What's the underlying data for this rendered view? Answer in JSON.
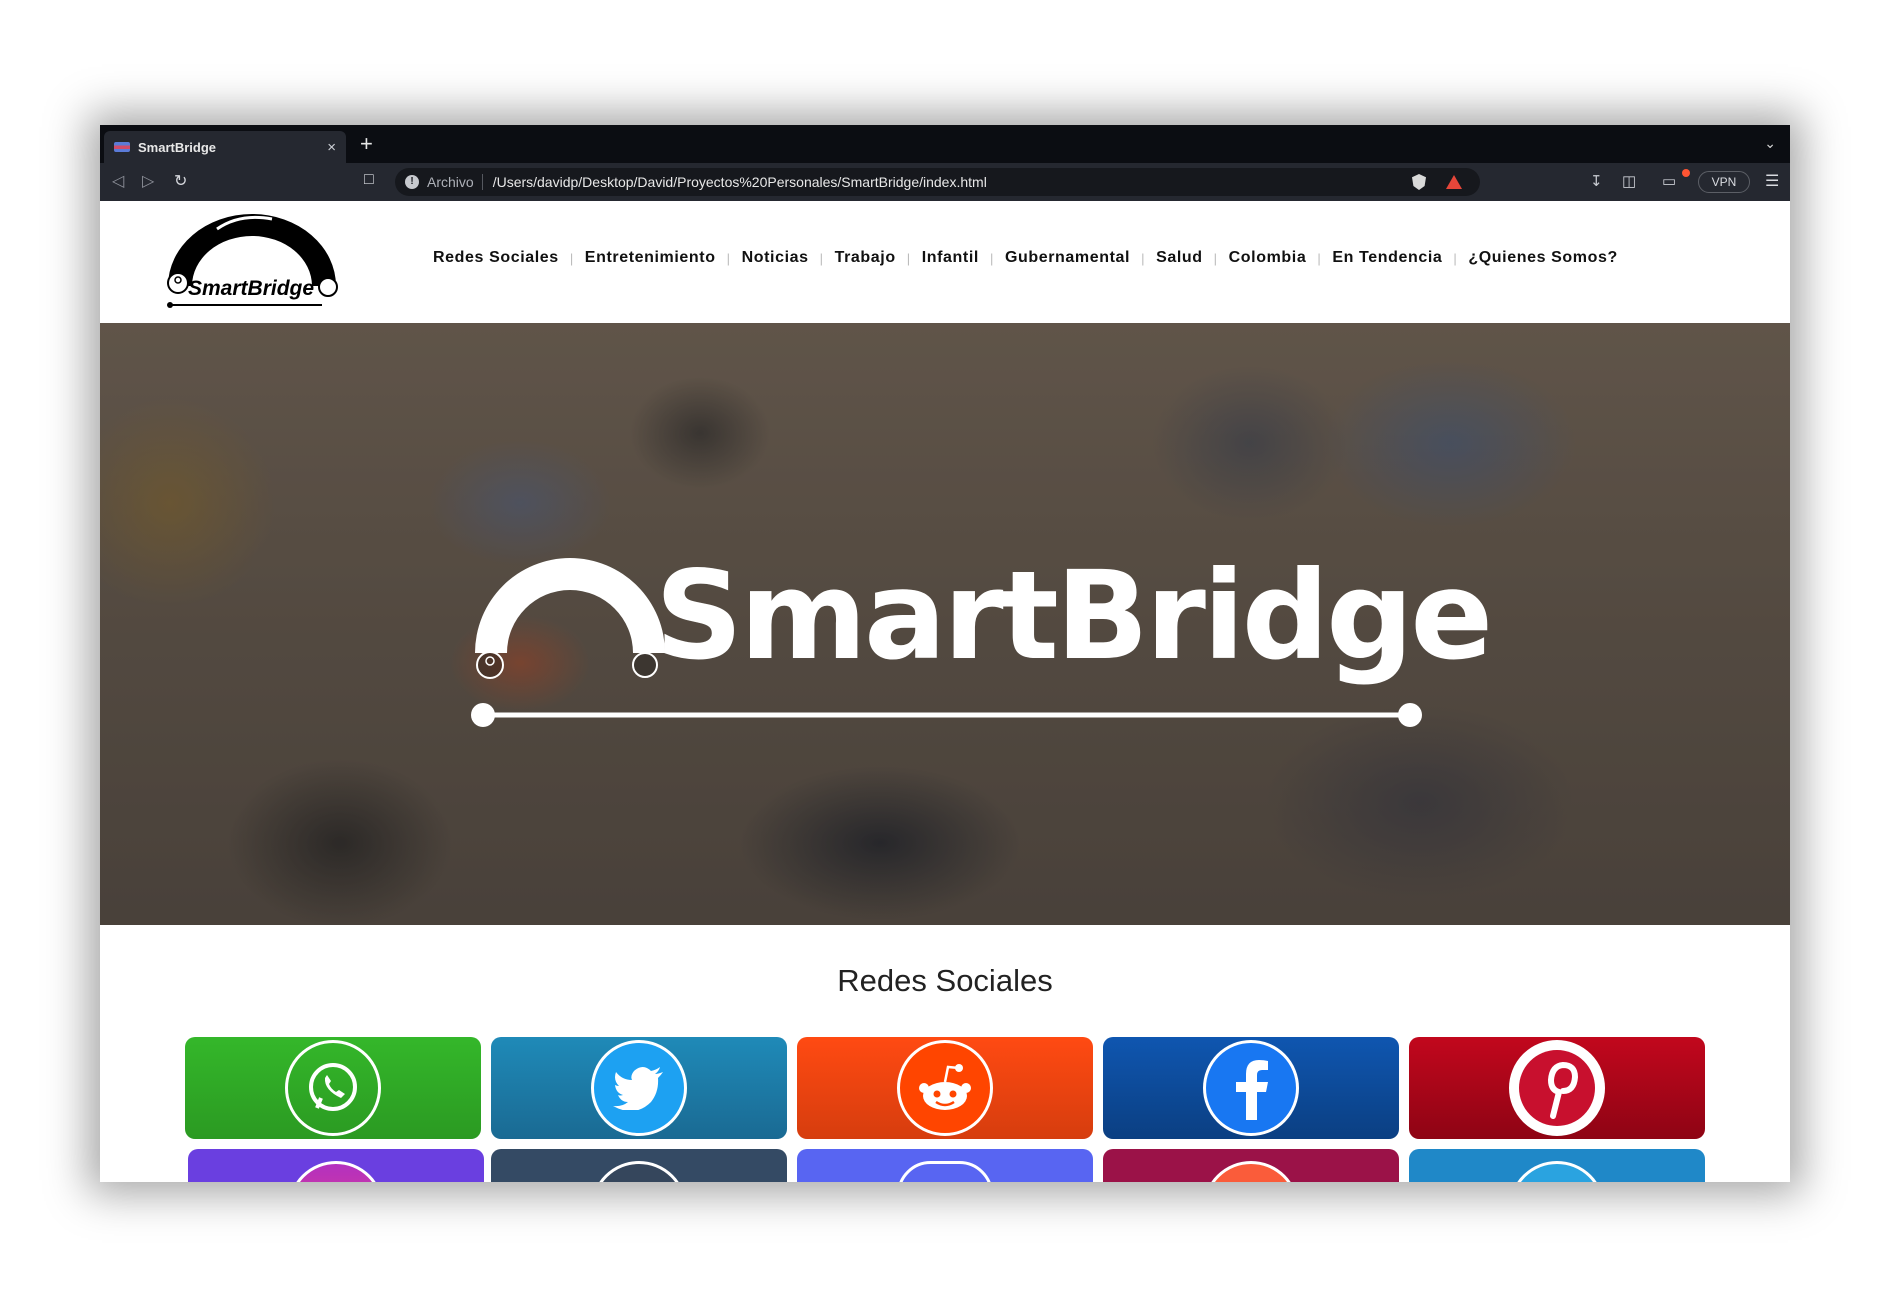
{
  "browser": {
    "tab_title": "SmartBridge",
    "tab_close": "×",
    "new_tab": "+",
    "scheme_label": "Archivo",
    "url": "/Users/davidp/Desktop/David/Proyectos%20Personales/SmartBridge/index.html",
    "vpn_label": "VPN"
  },
  "header": {
    "logo_text": "SmartBridge",
    "nav": [
      "Redes Sociales",
      "Entretenimiento",
      "Noticias",
      "Trabajo",
      "Infantil",
      "Gubernamental",
      "Salud",
      "Colombia",
      "En Tendencia",
      "¿Quienes Somos?"
    ]
  },
  "hero": {
    "wordmark": "SmartBridge"
  },
  "section": {
    "title": "Redes Sociales"
  },
  "social_tiles": [
    {
      "name": "whatsapp",
      "color_top": "#34b72a",
      "color_bottom": "#2b9a22"
    },
    {
      "name": "twitter",
      "color_top": "#1f8ab8",
      "color_bottom": "#1a6a93"
    },
    {
      "name": "reddit",
      "color_top": "#ff4a12",
      "color_bottom": "#d63d0e"
    },
    {
      "name": "facebook",
      "color_top": "#0f56b0",
      "color_bottom": "#0b3f82"
    },
    {
      "name": "pinterest",
      "color_top": "#c2071d",
      "color_bottom": "#8e0414"
    }
  ],
  "social_tiles_row2": [
    {
      "name": "instagram",
      "color": "#6a3fe0"
    },
    {
      "name": "tumblr",
      "color": "#344a64"
    },
    {
      "name": "discord",
      "color": "#5865f2"
    },
    {
      "name": "tiktok-music",
      "color": "#9b1248"
    },
    {
      "name": "telegram",
      "color": "#1f88c8"
    }
  ]
}
